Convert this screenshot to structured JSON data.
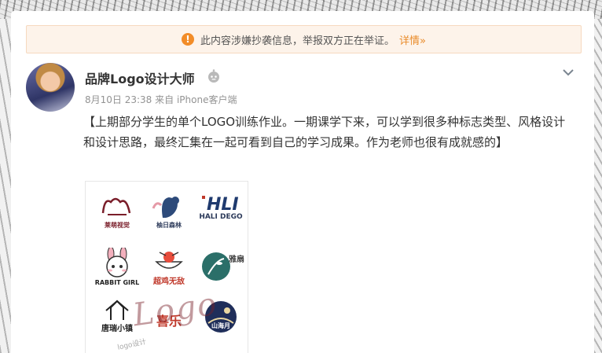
{
  "notice": {
    "icon": "warning-icon",
    "text": "此内容涉嫌抄袭信息，举报双方正在举证。",
    "link": "详情»"
  },
  "post": {
    "user_name": "品牌Logo设计大师",
    "timestamp": "8月10日 23:38",
    "source": "来自 iPhone客户端",
    "text": "【上期部分学生的单个LOGO训练作业。一期课学下来，可以学到很多种标志类型、风格设计和设计思路，最终汇集在一起可看到自己的学习成果。作为老师也很有成就感的】"
  },
  "thumbnail": {
    "logos": [
      {
        "label": "莱萌视觉"
      },
      {
        "label": "柚日森林"
      },
      {
        "label": "HALI DEGO"
      },
      {
        "label": "RABBIT GIRL"
      },
      {
        "label": "超鸡无敌"
      },
      {
        "label": "雅扇"
      },
      {
        "label": "唐瑞小镇"
      },
      {
        "label": "喜乐"
      },
      {
        "label": "山海月"
      }
    ],
    "watermark": "Logo",
    "watermark_sub": "logo设计"
  },
  "colors": {
    "notice_bg": "#fdf3ea",
    "notice_icon": "#f28c28",
    "link": "#e98b2a",
    "meta_gray": "#939393"
  }
}
